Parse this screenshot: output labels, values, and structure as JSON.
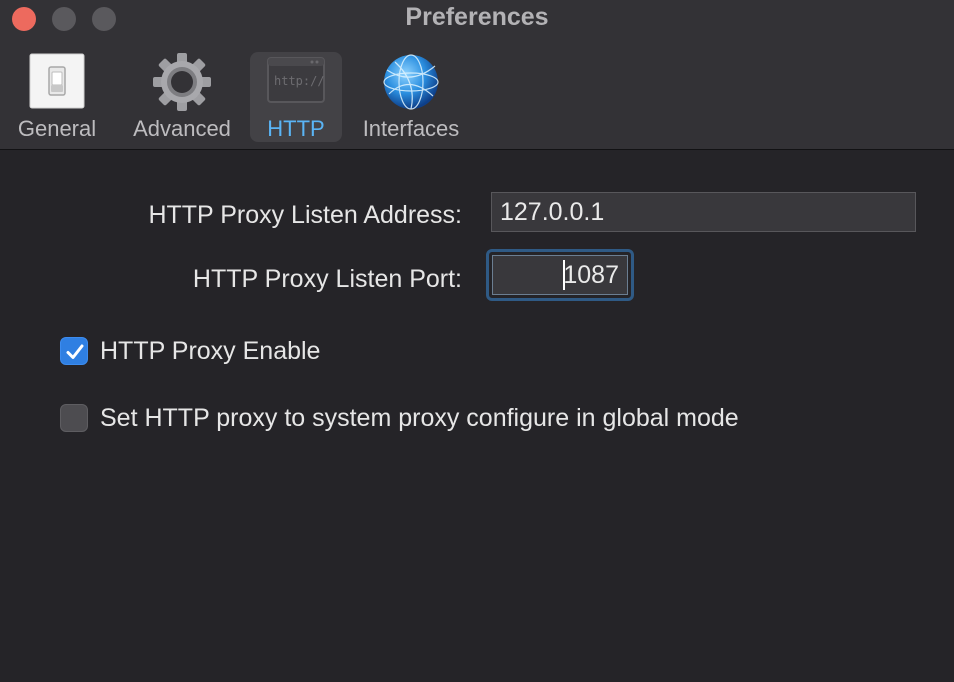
{
  "window": {
    "title": "Preferences"
  },
  "tabs": [
    {
      "label": "General",
      "icon": "light-switch-icon",
      "selected": false
    },
    {
      "label": "Advanced",
      "icon": "gear-icon",
      "selected": false
    },
    {
      "label": "HTTP",
      "icon": "http-browser-icon",
      "selected": true
    },
    {
      "label": "Interfaces",
      "icon": "network-globe-icon",
      "selected": false
    }
  ],
  "form": {
    "address_label": "HTTP Proxy Listen Address:",
    "address_value": "127.0.0.1",
    "port_label": "HTTP Proxy Listen Port:",
    "port_value": "1087"
  },
  "options": {
    "enable_label": "HTTP Proxy Enable",
    "enable_checked": true,
    "system_label": "Set HTTP proxy to system proxy configure in global mode",
    "system_checked": false
  },
  "colors": {
    "accent": "#5ab4f5",
    "checkbox_checked": "#2f7fe2",
    "close_button": "#ed6a5e"
  }
}
